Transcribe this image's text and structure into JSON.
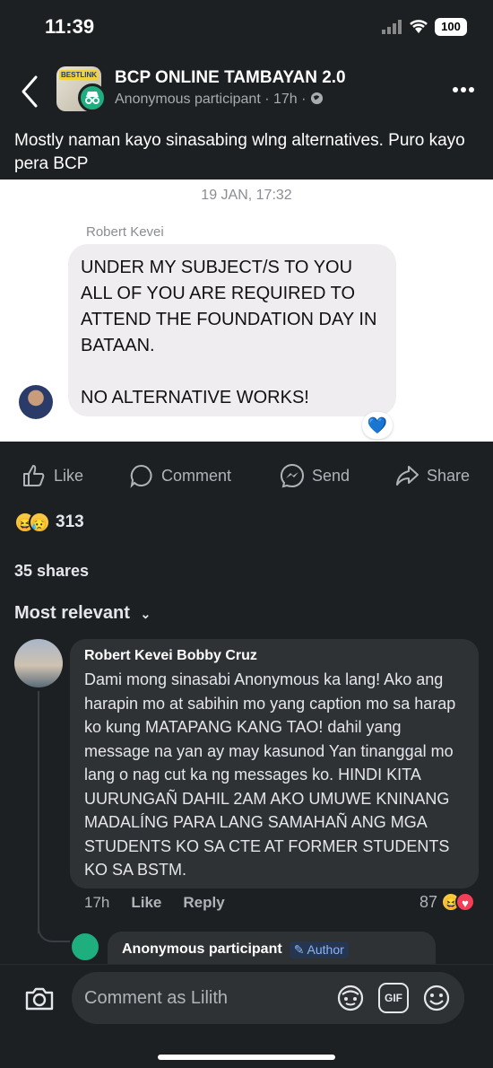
{
  "status_bar": {
    "time": "11:39",
    "battery": "100"
  },
  "header": {
    "group_name": "BCP ONLINE TAMBAYAN 2.0",
    "avatar_tag": "BESTLINK",
    "poster": "Anonymous participant",
    "time_ago": "17h",
    "visibility_icon": "globe-icon"
  },
  "post": {
    "text": "Mostly naman kayo sinasabing wlng alternatives. Puro kayo pera BCP"
  },
  "screenshot": {
    "date": "19 JAN, 17:32",
    "sender": "Robert Kevei",
    "message": "UNDER MY SUBJECT/S TO YOU ALL OF YOU ARE REQUIRED TO ATTEND THE FOUNDATION DAY IN BATAAN.\n\nNO ALTERNATIVE WORKS!",
    "reaction": "💙"
  },
  "actions": {
    "like": "Like",
    "comment": "Comment",
    "send": "Send",
    "share": "Share"
  },
  "stats": {
    "reaction_count": "313",
    "shares": "35 shares"
  },
  "sort_label": "Most relevant",
  "comment": {
    "author": "Robert Kevei Bobby Cruz",
    "text": "Dami mong sinasabi Anonymous ka lang! Ako ang harapin mo at sabihin mo yang caption mo sa harap ko kung MATAPANG KANG TAO! dahil yang message na yan ay may kasunod Yan tinanggal mo lang o nag cut ka ng messages ko. HINDI KITA UURUNGAÑ DAHIL 2AM AKO UMUWE KNINANG MADALÍNG PARA LANG SAMAHAÑ ANG MGA STUDENTS KO SA CTE AT FORMER STUDENTS KO SA BSTM.",
    "time": "17h",
    "like": "Like",
    "reply": "Reply",
    "reaction_count": "87"
  },
  "reply": {
    "author": "Anonymous participant",
    "badge": "Author"
  },
  "composer": {
    "placeholder": "Comment as Lilith",
    "gif": "GIF"
  },
  "colors": {
    "background": "#1d2023",
    "bubble": "#2f3235",
    "anon_green": "#1fae7e",
    "heart_blue": "#1e6fd9"
  }
}
